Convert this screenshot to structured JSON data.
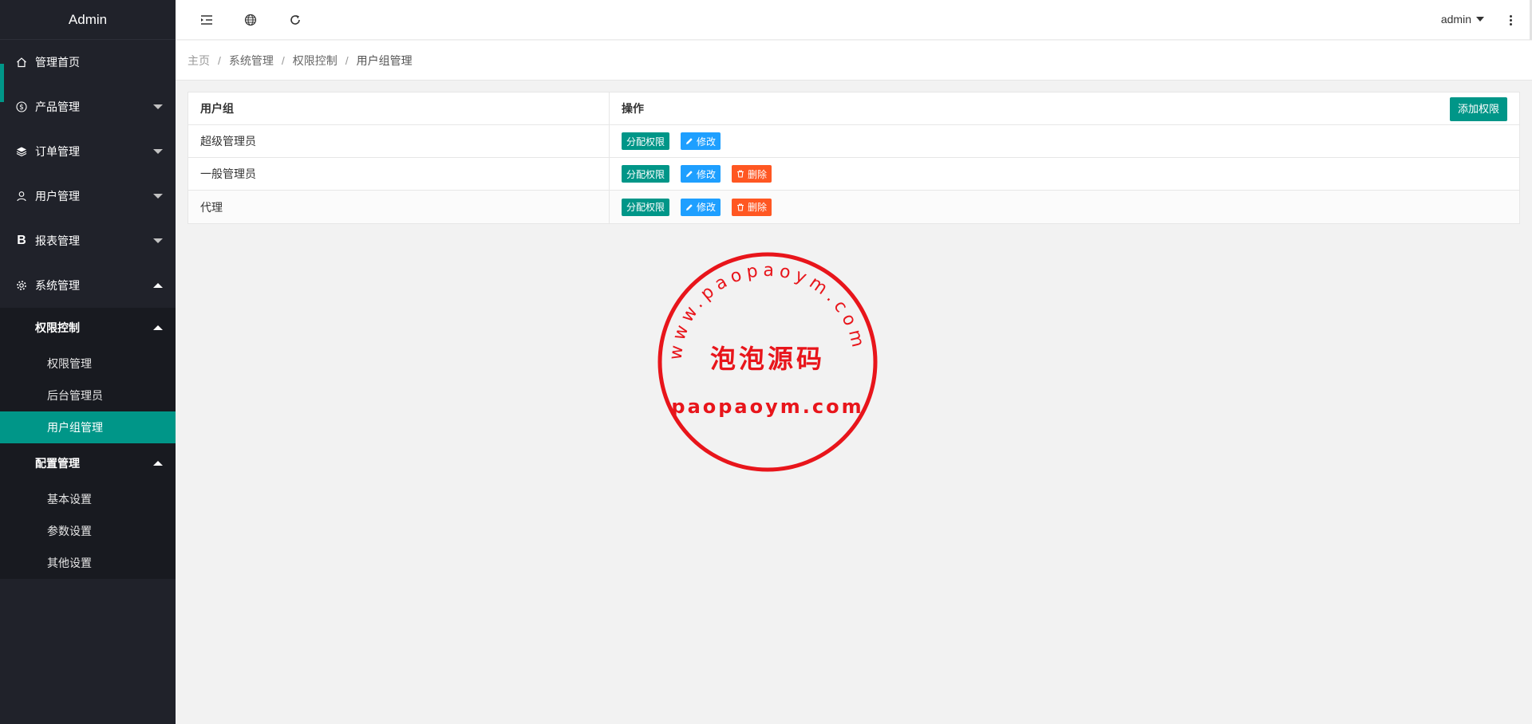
{
  "app": {
    "title": "Admin"
  },
  "sidebar": {
    "items": [
      {
        "label": "管理首页",
        "icon": "home-icon"
      },
      {
        "label": "产品管理",
        "icon": "dollar-circle-icon"
      },
      {
        "label": "订单管理",
        "icon": "layers-icon"
      },
      {
        "label": "用户管理",
        "icon": "user-icon"
      },
      {
        "label": "报表管理",
        "icon": "bold-b-icon",
        "icon_text": "B"
      },
      {
        "label": "系统管理",
        "icon": "gear-icon"
      }
    ],
    "groups": [
      {
        "label": "权限控制",
        "items": [
          "权限管理",
          "后台管理员",
          "用户组管理"
        ]
      },
      {
        "label": "配置管理",
        "items": [
          "基本设置",
          "参数设置",
          "其他设置"
        ]
      }
    ]
  },
  "header": {
    "user": "admin"
  },
  "breadcrumb": [
    "主页",
    "系统管理",
    "权限控制",
    "用户组管理"
  ],
  "table": {
    "headers": [
      "用户组",
      "操作"
    ],
    "add_label": "添加权限",
    "rows": [
      {
        "name": "超级管理员",
        "actions": [
          "分配权限",
          "修改"
        ]
      },
      {
        "name": "一般管理员",
        "actions": [
          "分配权限",
          "修改",
          "删除"
        ]
      },
      {
        "name": "代理",
        "actions": [
          "分配权限",
          "修改",
          "删除"
        ]
      }
    ]
  },
  "watermark": {
    "arc_text": "www.paopaoym.com",
    "center_text": "泡泡源码",
    "bottom_text": "paopaoym.com",
    "color": "#e8151b"
  },
  "colors": {
    "accent": "#009688",
    "blue": "#1e9fff",
    "danger": "#ff5722",
    "sidebar_bg": "#20222a"
  }
}
